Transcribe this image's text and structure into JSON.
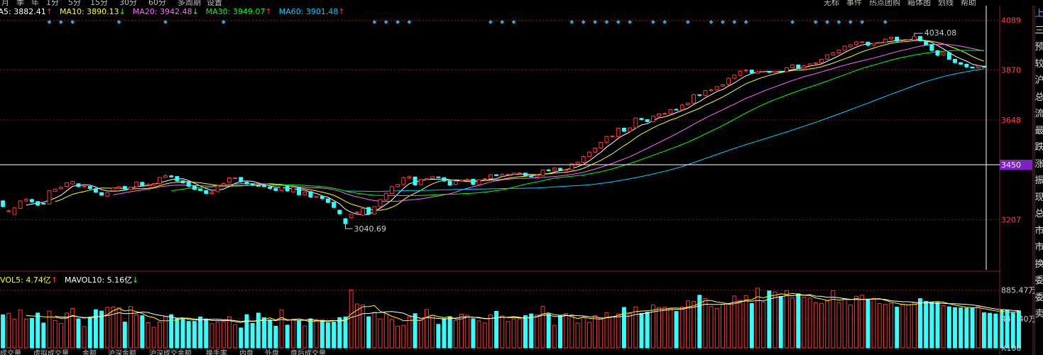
{
  "toolbar": {
    "left_items": [
      "月",
      "季",
      "年",
      "1分",
      "5分",
      "15分",
      "30分",
      "60分",
      "多周期",
      "设置"
    ],
    "right_items": [
      "无标",
      "事件",
      "热点团购",
      "箱体图",
      "划线",
      "帮助"
    ]
  },
  "indicators": {
    "ma": [
      {
        "label": "MA5: 3882.41",
        "arrow": "↑",
        "color": "#ffffff"
      },
      {
        "label": "MA10: 3890.13",
        "arrow": "↓",
        "color": "#ffff00"
      },
      {
        "label": "MA20: 3942.48",
        "arrow": "↓",
        "color": "#ff66ff"
      },
      {
        "label": "MA30: 3949.07",
        "arrow": "↑",
        "color": "#00ff00"
      },
      {
        "label": "MA60: 3901.48",
        "arrow": "↑",
        "color": "#00ccff"
      }
    ],
    "vol": [
      {
        "label": "VOL5: 4.74亿",
        "arrow": "↑",
        "color": "#ffff00"
      },
      {
        "label": "MAVOL10: 5.16亿",
        "arrow": "↓",
        "color": "#ffffff"
      }
    ]
  },
  "bottom_tabs": [
    "成交量",
    "虚拟成交量",
    "金额",
    "沪深金额",
    "沪深成交金额",
    "换手率",
    "内盘",
    "外盘",
    "盘后成交量"
  ],
  "right_panel_chars": [
    "上",
    "三",
    "预",
    "较",
    "沪",
    "总",
    "流",
    "最",
    "跌",
    "涨",
    "振",
    "现",
    "总",
    "市",
    "市",
    "换",
    "委",
    "委",
    "卖"
  ],
  "colors": {
    "up": "#ff3333",
    "down": "#33ffff",
    "grid": "#7a1a1a",
    "axis_text": "#ff4040",
    "crosshair": "#ffffff",
    "price_tag_bg": "#7f1fc6"
  },
  "chart_data": [
    {
      "type": "candlestick",
      "y_ticks": [
        4089,
        3870,
        3648,
        3450,
        3207
      ],
      "ylim": [
        2985,
        4110
      ],
      "current_price_label": "3450",
      "high_label": "4034.08",
      "low_label": "3040.69",
      "ma_periods": [
        5,
        10,
        20,
        30,
        60
      ],
      "series": {
        "open": [
          3290,
          3245,
          3230,
          3257,
          3290,
          3296,
          3287,
          3279,
          3276,
          3332,
          3344,
          3354,
          3365,
          3366,
          3354,
          3354,
          3344,
          3327,
          3311,
          3335,
          3348,
          3354,
          3341,
          3353,
          3372,
          3362,
          3362,
          3367,
          3394,
          3401,
          3398,
          3379,
          3373,
          3357,
          3342,
          3336,
          3323,
          3331,
          3359,
          3372,
          3392,
          3394,
          3373,
          3366,
          3358,
          3360,
          3351,
          3345,
          3336,
          3355,
          3330,
          3350,
          3317,
          3331,
          3308,
          3310,
          3299,
          3284,
          3249,
          3211,
          3215,
          3240,
          3227,
          3261,
          3231,
          3265,
          3294,
          3323,
          3353,
          3362,
          3392,
          3396,
          3362,
          3386,
          3389,
          3396,
          3393,
          3377,
          3363,
          3377,
          3382,
          3386,
          3362,
          3385,
          3389,
          3406,
          3400,
          3407,
          3408,
          3411,
          3413,
          3400,
          3396,
          3402,
          3427,
          3425,
          3434,
          3426,
          3428,
          3453,
          3461,
          3486,
          3506,
          3525,
          3550,
          3575,
          3574,
          3612,
          3598,
          3614,
          3655,
          3650,
          3641,
          3664,
          3674,
          3677,
          3695,
          3694,
          3716,
          3723,
          3760,
          3756,
          3779,
          3782,
          3798,
          3805,
          3833,
          3846,
          3866,
          3869,
          3855,
          3863,
          3864,
          3859,
          3864,
          3862,
          3879,
          3892,
          3878,
          3890,
          3898,
          3902,
          3917,
          3935,
          3945,
          3956,
          3972,
          3982,
          3993,
          3993,
          3979,
          3988,
          3992,
          4007,
          4015,
          3997,
          3999,
          4003,
          4018,
          3998,
          3982,
          3955,
          3935,
          3946,
          3917,
          3902,
          3895,
          3882,
          3879,
          3886
        ],
        "close": [
          3265,
          3246,
          3259,
          3290,
          3297,
          3286,
          3271,
          3276,
          3336,
          3342,
          3350,
          3370,
          3376,
          3354,
          3355,
          3345,
          3329,
          3315,
          3327,
          3347,
          3353,
          3342,
          3351,
          3374,
          3358,
          3362,
          3367,
          3394,
          3401,
          3396,
          3378,
          3370,
          3355,
          3341,
          3336,
          3323,
          3330,
          3356,
          3367,
          3392,
          3392,
          3375,
          3365,
          3359,
          3357,
          3353,
          3345,
          3336,
          3358,
          3334,
          3351,
          3317,
          3330,
          3307,
          3309,
          3300,
          3283,
          3261,
          3233,
          3189,
          3230,
          3240,
          3256,
          3232,
          3265,
          3296,
          3324,
          3353,
          3363,
          3393,
          3397,
          3361,
          3385,
          3388,
          3397,
          3393,
          3378,
          3360,
          3377,
          3381,
          3385,
          3363,
          3384,
          3388,
          3406,
          3402,
          3408,
          3408,
          3413,
          3414,
          3402,
          3397,
          3403,
          3427,
          3425,
          3436,
          3427,
          3428,
          3454,
          3462,
          3486,
          3506,
          3524,
          3549,
          3575,
          3577,
          3612,
          3598,
          3613,
          3657,
          3650,
          3641,
          3665,
          3675,
          3677,
          3694,
          3693,
          3714,
          3723,
          3760,
          3757,
          3778,
          3781,
          3796,
          3804,
          3833,
          3847,
          3864,
          3869,
          3857,
          3862,
          3863,
          3859,
          3864,
          3861,
          3879,
          3892,
          3878,
          3888,
          3897,
          3902,
          3917,
          3937,
          3946,
          3958,
          3975,
          3981,
          3993,
          3994,
          3979,
          3988,
          3992,
          4006,
          4015,
          3997,
          3999,
          4004,
          4018,
          3998,
          3980,
          3956,
          3935,
          3946,
          3917,
          3902,
          3895,
          3883,
          3878,
          3887,
          3882
        ],
        "high": [
          3294,
          3252,
          3262,
          3293,
          3302,
          3300,
          3289,
          3280,
          3337,
          3345,
          3357,
          3372,
          3379,
          3366,
          3361,
          3355,
          3349,
          3329,
          3329,
          3351,
          3356,
          3357,
          3353,
          3376,
          3376,
          3368,
          3370,
          3396,
          3409,
          3405,
          3399,
          3380,
          3378,
          3359,
          3344,
          3338,
          3333,
          3358,
          3371,
          3395,
          3395,
          3395,
          3375,
          3369,
          3362,
          3363,
          3352,
          3346,
          3359,
          3357,
          3353,
          3353,
          3332,
          3334,
          3313,
          3312,
          3301,
          3286,
          3249,
          3214,
          3231,
          3245,
          3259,
          3263,
          3265,
          3296,
          3327,
          3358,
          3365,
          3398,
          3402,
          3396,
          3388,
          3391,
          3401,
          3398,
          3394,
          3379,
          3378,
          3384,
          3390,
          3387,
          3384,
          3392,
          3410,
          3408,
          3411,
          3410,
          3413,
          3414,
          3415,
          3401,
          3407,
          3430,
          3431,
          3436,
          3438,
          3433,
          3455,
          3463,
          3492,
          3510,
          3526,
          3551,
          3578,
          3579,
          3614,
          3613,
          3617,
          3659,
          3658,
          3645,
          3668,
          3679,
          3682,
          3696,
          3699,
          3720,
          3725,
          3764,
          3762,
          3782,
          3787,
          3797,
          3808,
          3836,
          3849,
          3869,
          3874,
          3869,
          3866,
          3866,
          3864,
          3866,
          3866,
          3882,
          3896,
          3893,
          3892,
          3898,
          3903,
          3919,
          3939,
          3951,
          3960,
          3978,
          3984,
          3999,
          3995,
          3994,
          3989,
          3995,
          4010,
          4016,
          4016,
          4004,
          4005,
          4022,
          4019,
          4000,
          3983,
          3957,
          3948,
          3949,
          3918,
          3904,
          3898,
          3885,
          3883,
          3889
        ],
        "low": [
          3260,
          3245,
          3228,
          3255,
          3285,
          3281,
          3266,
          3273,
          3275,
          3331,
          3340,
          3350,
          3362,
          3349,
          3353,
          3339,
          3324,
          3313,
          3310,
          3332,
          3345,
          3339,
          3340,
          3350,
          3354,
          3361,
          3359,
          3362,
          3391,
          3393,
          3375,
          3366,
          3350,
          3337,
          3335,
          3319,
          3322,
          3329,
          3355,
          3369,
          3390,
          3370,
          3361,
          3355,
          3355,
          3350,
          3339,
          3333,
          3332,
          3330,
          3327,
          3314,
          3315,
          3303,
          3305,
          3294,
          3280,
          3258,
          3228,
          3186,
          3211,
          3238,
          3224,
          3228,
          3228,
          3260,
          3290,
          3322,
          3350,
          3358,
          3387,
          3357,
          3360,
          3384,
          3386,
          3390,
          3374,
          3356,
          3358,
          3376,
          3379,
          3359,
          3360,
          3382,
          3385,
          3399,
          3397,
          3406,
          3404,
          3409,
          3398,
          3393,
          3395,
          3399,
          3421,
          3421,
          3425,
          3423,
          3425,
          3448,
          3457,
          3484,
          3500,
          3519,
          3545,
          3571,
          3572,
          3594,
          3595,
          3609,
          3647,
          3637,
          3637,
          3658,
          3672,
          3673,
          3690,
          3691,
          3710,
          3718,
          3752,
          3754,
          3773,
          3779,
          3793,
          3801,
          3828,
          3842,
          3860,
          3852,
          3853,
          3859,
          3854,
          3855,
          3858,
          3860,
          3876,
          3874,
          3872,
          3885,
          3893,
          3898,
          3914,
          3933,
          3943,
          3953,
          3968,
          3976,
          3989,
          3975,
          3974,
          3985,
          3990,
          4003,
          3993,
          3993,
          3996,
          3999,
          3995,
          3978,
          3950,
          3930,
          3932,
          3914,
          3898,
          3893,
          3879,
          3876,
          3874,
          3880
        ]
      }
    },
    {
      "type": "bar",
      "y_ticks": [
        "885.47万",
        "447.40万"
      ],
      "x_factor_label": "X100",
      "mavol_periods": [
        5,
        10
      ],
      "values": [
        5.07,
        5.31,
        4.37,
        5.79,
        4.41,
        4.51,
        5.34,
        3.81,
        5.65,
        4.2,
        3.74,
        5.34,
        6.04,
        4.46,
        3.27,
        4.55,
        5.85,
        5.64,
        6.22,
        6.28,
        6.16,
        3.96,
        6.34,
        5.05,
        4.93,
        3.86,
        3.14,
        3.97,
        4.79,
        5.09,
        4.46,
        4.44,
        4.06,
        4.06,
        4.74,
        4.43,
        3.71,
        3.98,
        4.02,
        4.78,
        3.56,
        3.06,
        5.09,
        3.75,
        5.33,
        4.63,
        4.26,
        3.33,
        5.79,
        3.49,
        4.39,
        4.16,
        3.35,
        4.46,
        4.33,
        4.23,
        3.86,
        3.96,
        4.64,
        4.74,
        8.86,
        6.73,
        6.57,
        4.77,
        5.44,
        4.44,
        5.22,
        4.34,
        3.33,
        3.46,
        4.75,
        5.24,
        4.27,
        5.89,
        4.97,
        3.61,
        4.49,
        4.79,
        4.18,
        5.16,
        5.01,
        4.46,
        4.15,
        3.81,
        5.07,
        5.61,
        4.91,
        4.04,
        4.44,
        4.44,
        4.94,
        5.21,
        5.06,
        6.38,
        5.19,
        3.46,
        4.91,
        5.27,
        5.07,
        3.81,
        4.6,
        3.92,
        4.94,
        4.58,
        5.39,
        4.83,
        5.2,
        6.2,
        5.25,
        6.29,
        5.27,
        5.48,
        6.57,
        6.19,
        6.23,
        6.04,
        5.58,
        6.27,
        7.21,
        7.1,
        8.07,
        7.56,
        6.33,
        6.05,
        6.66,
        6.83,
        7.94,
        7.29,
        8.03,
        6.81,
        9.15,
        7.02,
        8.73,
        8.57,
        7.88,
        8.77,
        7.67,
        8.28,
        7.79,
        7.62,
        6.92,
        6.82,
        7.17,
        8.77,
        6.94,
        7.5,
        6.58,
        7.91,
        8.08,
        7.33,
        7.59,
        6.79,
        6.66,
        6.81,
        6.24,
        6.7,
        6.58,
        6.91,
        7.54,
        7.13,
        6.98,
        6.93,
        6.46,
        6.29,
        6.17,
        6.13,
        6.08,
        6.09,
        6.33,
        5.38,
        5.31,
        5.2,
        5.76,
        5.8,
        5.34,
        5.68
      ]
    }
  ]
}
